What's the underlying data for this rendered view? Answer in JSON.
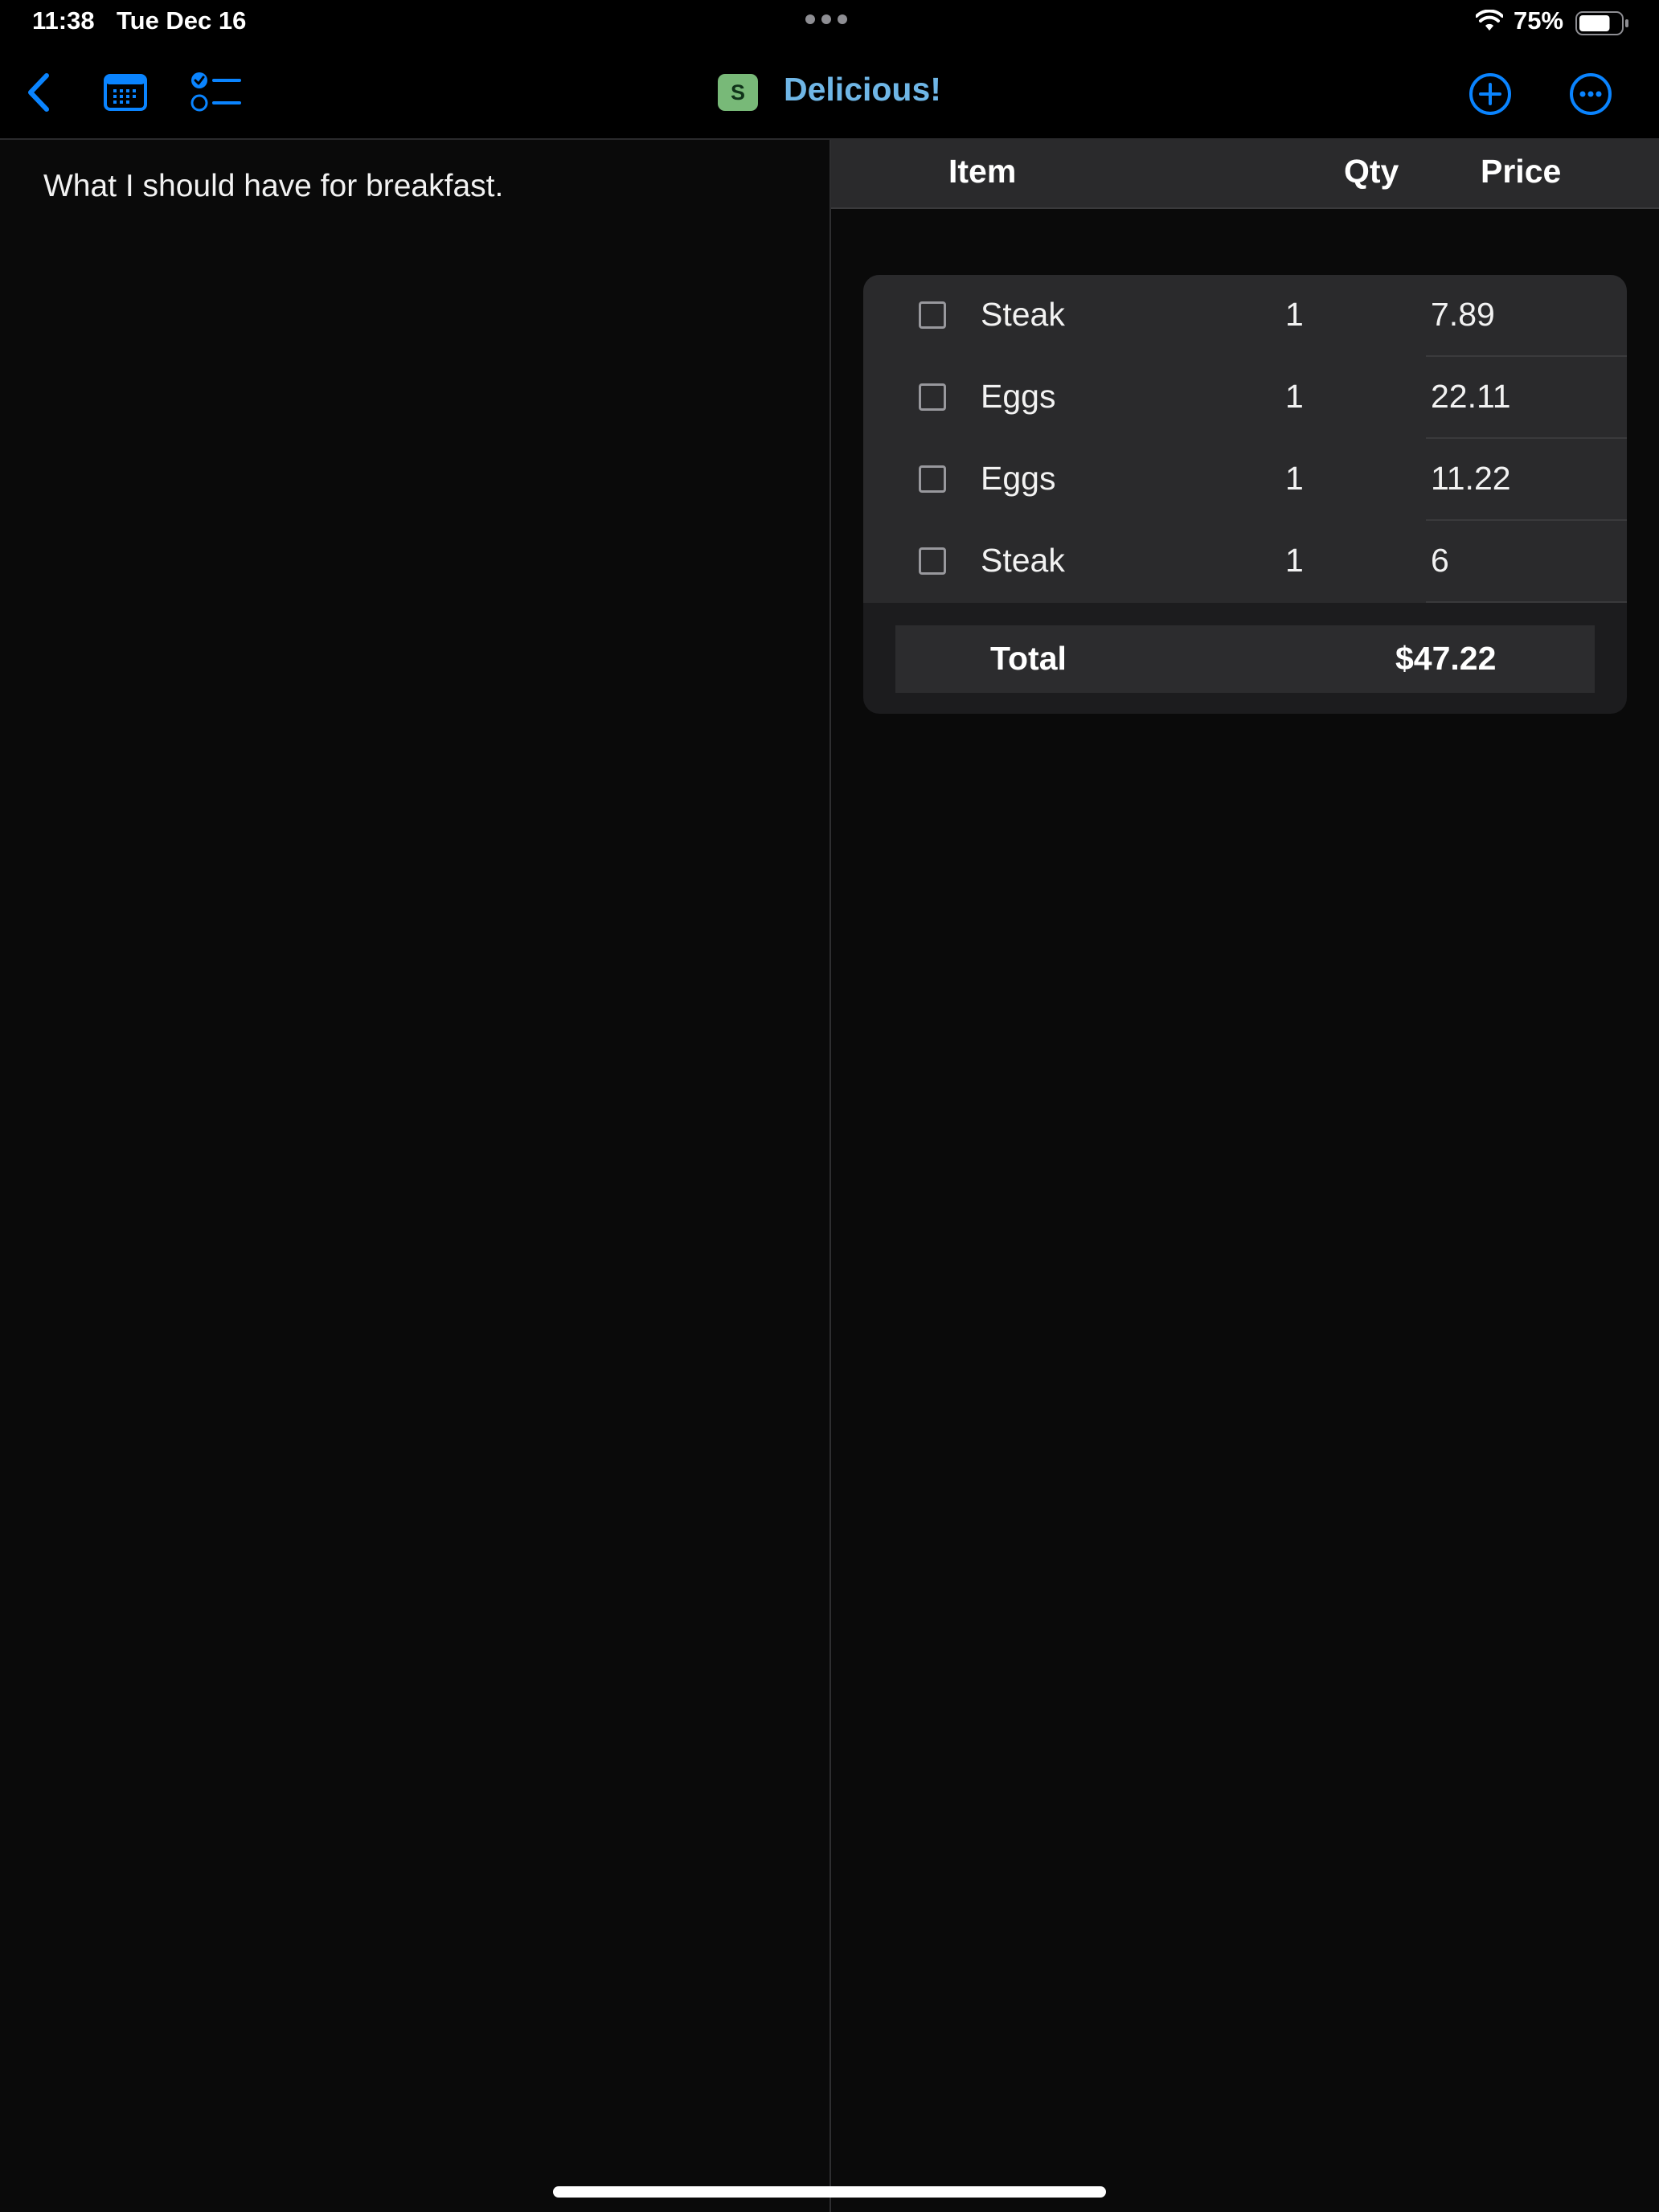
{
  "status_bar": {
    "time": "11:38",
    "date": "Tue Dec 16",
    "battery_percent": "75%",
    "battery_level": 0.75
  },
  "nav": {
    "badge_letter": "S",
    "badge_color": "#78b978",
    "title": "Delicious!",
    "title_color": "#6fb6e6",
    "accent_color": "#0a84ff",
    "icons": [
      "chevron-left-icon",
      "calendar-icon",
      "checklist-icon",
      "plus-circle-icon",
      "ellipsis-circle-icon"
    ]
  },
  "note": {
    "text": "What I should have for breakfast."
  },
  "table": {
    "columns": [
      "Item",
      "Qty",
      "Price"
    ],
    "rows": [
      {
        "item": "Steak",
        "qty": "1",
        "price": "7.89",
        "checked": false
      },
      {
        "item": "Eggs",
        "qty": "1",
        "price": "22.11",
        "checked": false
      },
      {
        "item": "Eggs",
        "qty": "1",
        "price": "11.22",
        "checked": false
      },
      {
        "item": "Steak",
        "qty": "1",
        "price": "6",
        "checked": false
      }
    ],
    "total_label": "Total",
    "total_value": "$47.22"
  }
}
